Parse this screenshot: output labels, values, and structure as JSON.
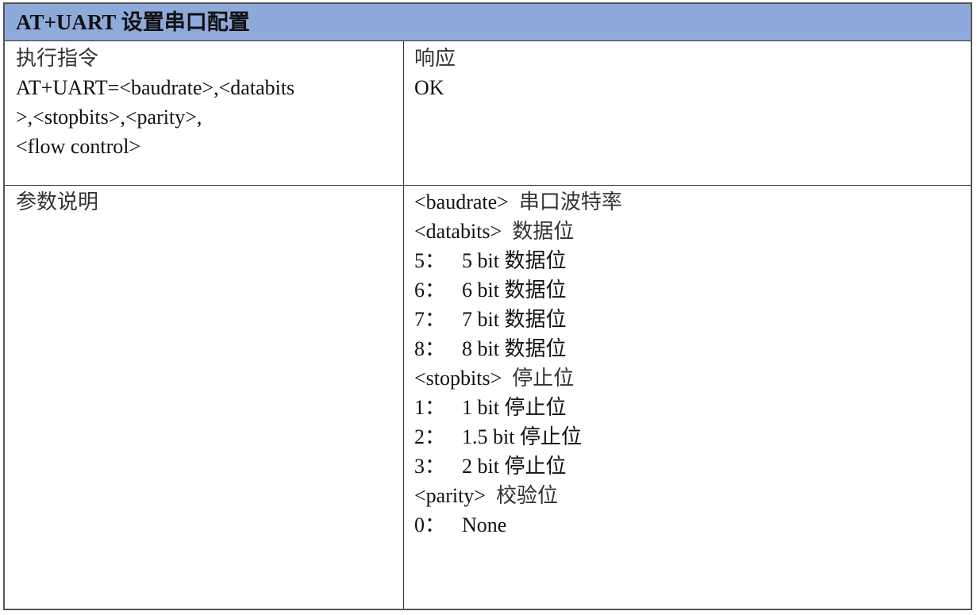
{
  "header": {
    "title": "AT+UART 设置串口配置",
    "background": "#8eaadb"
  },
  "row1": {
    "left": {
      "label": "执行指令",
      "command_lines": [
        "AT+UART=<baudrate>,<databits",
        ">,<stopbits>,<parity>,",
        "<flow control>"
      ]
    },
    "right": {
      "label": "响应",
      "value": "OK"
    }
  },
  "row2": {
    "left": {
      "label": "参数说明"
    },
    "right": {
      "params": [
        {
          "name": "<baudrate>",
          "desc": "串口波特率"
        },
        {
          "name": "<databits>",
          "desc": "数据位"
        },
        {
          "code": "5：",
          "text": "5 bit 数据位"
        },
        {
          "code": "6：",
          "text": "6 bit 数据位"
        },
        {
          "code": "7：",
          "text": "7 bit 数据位"
        },
        {
          "code": "8：",
          "text": "8 bit 数据位"
        },
        {
          "name": "<stopbits>",
          "desc": "停止位"
        },
        {
          "code": "1：",
          "text": "1 bit 停止位"
        },
        {
          "code": "2：",
          "text": "1.5 bit 停止位"
        },
        {
          "code": "3：",
          "text": "2 bit 停止位"
        },
        {
          "name": "<parity>",
          "desc": "校验位"
        },
        {
          "code": "0：",
          "text": "None"
        }
      ]
    }
  }
}
